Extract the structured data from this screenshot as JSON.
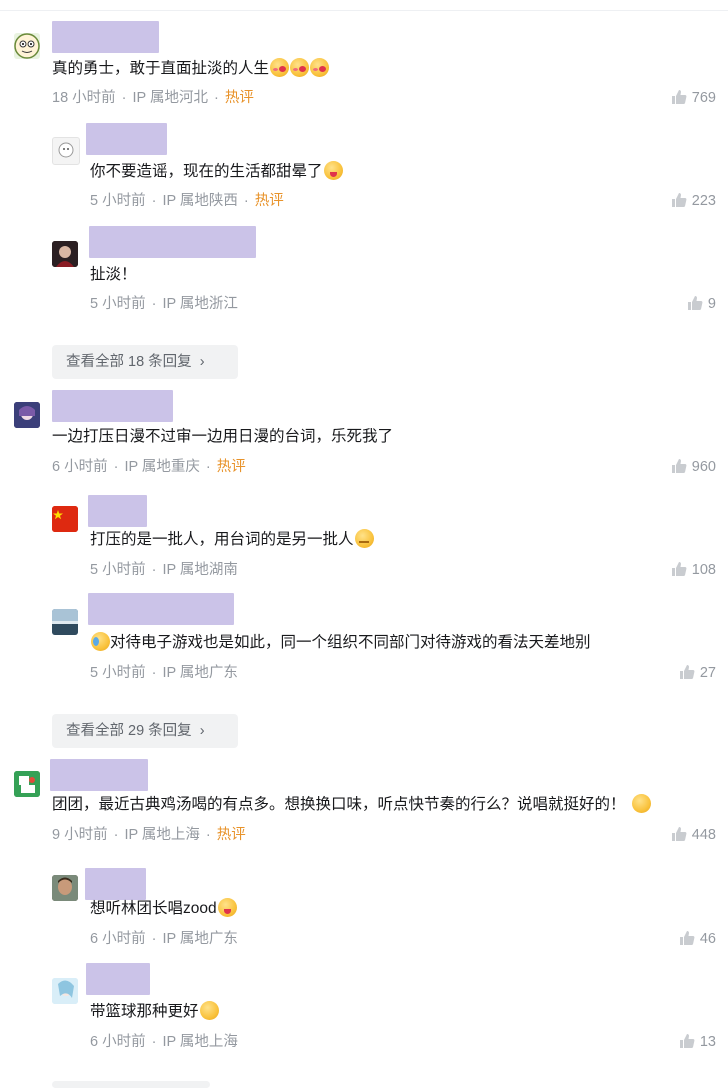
{
  "comments": [
    {
      "text": "真的勇士，敢于直面扯淡的人生",
      "time": "18 小时前",
      "ip": "IP 属地河北",
      "hot": "热评",
      "likes": "769",
      "replies": [
        {
          "text": "你不要造谣，现在的生活都甜晕了",
          "time": "5 小时前",
          "ip": "IP 属地陕西",
          "hot": "热评",
          "likes": "223"
        },
        {
          "text": "扯淡！",
          "time": "5 小时前",
          "ip": "IP 属地浙江",
          "likes": "9"
        }
      ],
      "more": "查看全部 18 条回复"
    },
    {
      "text": "一边打压日漫不过审一边用日漫的台词，乐死我了",
      "time": "6 小时前",
      "ip": "IP 属地重庆",
      "hot": "热评",
      "likes": "960",
      "replies": [
        {
          "text": "打压的是一批人，用台词的是另一批人",
          "time": "5 小时前",
          "ip": "IP 属地湖南",
          "likes": "108"
        },
        {
          "text": "对待电子游戏也是如此，同一个组织不同部门对待游戏的看法天差地别",
          "time": "5 小时前",
          "ip": "IP 属地广东",
          "likes": "27"
        }
      ],
      "more": "查看全部 29 条回复"
    },
    {
      "text": "团团，最近古典鸡汤喝的有点多。想换换口味，听点快节奏的行么？说唱就挺好的！",
      "time": "9 小时前",
      "ip": "IP 属地上海",
      "hot": "热评",
      "likes": "448",
      "replies": [
        {
          "text": "想听林团长唱zood",
          "time": "6 小时前",
          "ip": "IP 属地广东",
          "likes": "46"
        },
        {
          "text": "带篮球那种更好",
          "time": "6 小时前",
          "ip": "IP 属地上海",
          "likes": "13"
        }
      ]
    }
  ],
  "icons": {
    "like": "thumbs-up-icon",
    "chevron": "chevron-right-icon"
  },
  "colors": {
    "hot": "#e8932b",
    "meta": "#9499a0",
    "redacted_name": "#cbc3e8"
  }
}
